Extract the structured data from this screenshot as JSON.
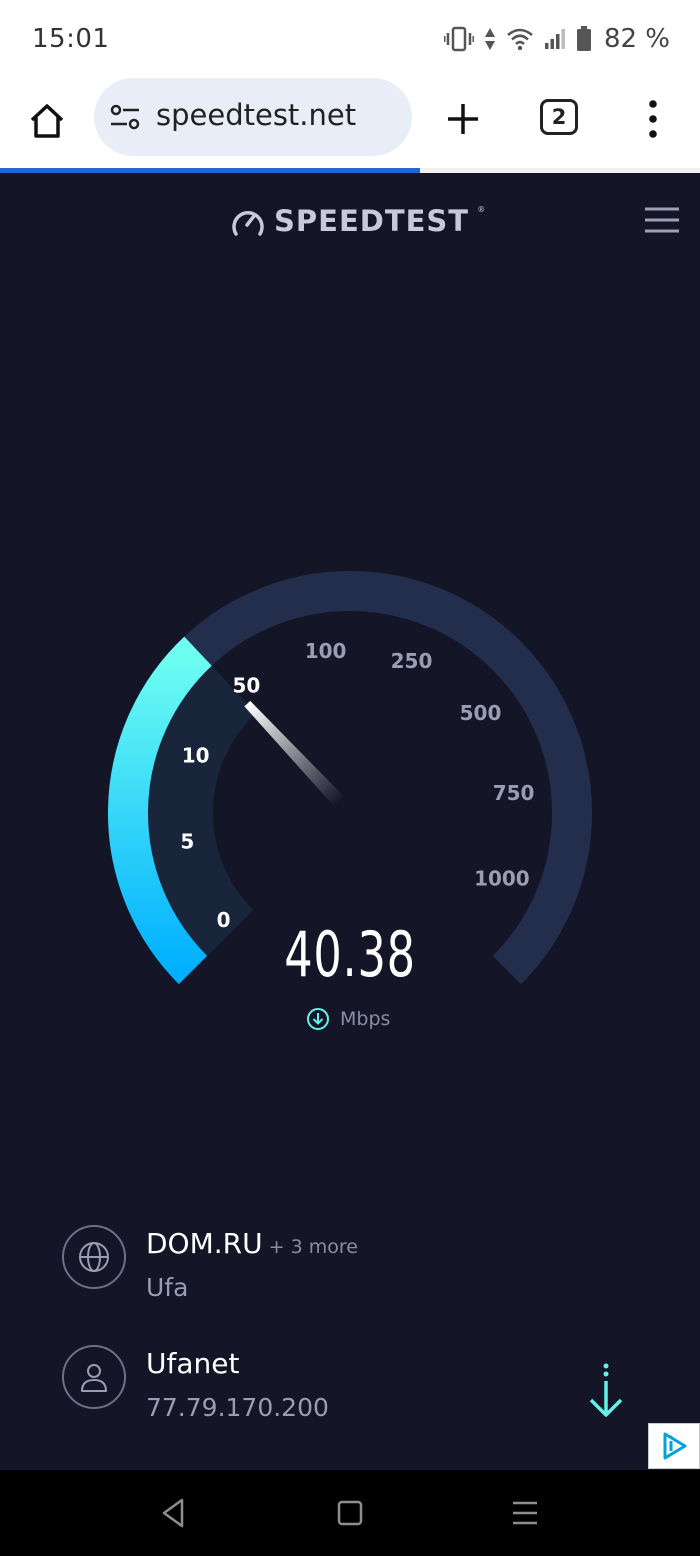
{
  "status_bar": {
    "time": "15:01",
    "battery_text": "82 %",
    "icons": [
      "vibrate-icon",
      "data-arrows-icon",
      "wifi-icon",
      "signal-icon",
      "battery-icon"
    ]
  },
  "browser": {
    "url": "speedtest.net",
    "tab_count": "2",
    "load_progress": 0.6,
    "icons": [
      "home-icon",
      "tune-icon",
      "plus-icon",
      "tabs-icon",
      "more-vert-icon"
    ]
  },
  "page": {
    "brand": "SPEEDTEST",
    "brand_tm": "®",
    "gauge": {
      "tick_labels": [
        "0",
        "5",
        "10",
        "50",
        "100",
        "250",
        "500",
        "750",
        "1000"
      ],
      "speed": "40.38",
      "unit": "Mbps",
      "fill_fraction": 0.34,
      "colors": {
        "track": "#232e4d",
        "fill_start": "#00b0ff",
        "fill_end": "#6ffff1",
        "needle": "#ffffff"
      }
    },
    "provider": {
      "name": "DOM.RU",
      "more": "+ 3 more",
      "location": "Ufa"
    },
    "server": {
      "name": "Ufanet",
      "ip": "77.79.170.200"
    },
    "accent_color": "#63f2e6"
  },
  "nav_bar": {
    "icons": [
      "back-icon",
      "home-square-icon",
      "recents-icon"
    ]
  }
}
